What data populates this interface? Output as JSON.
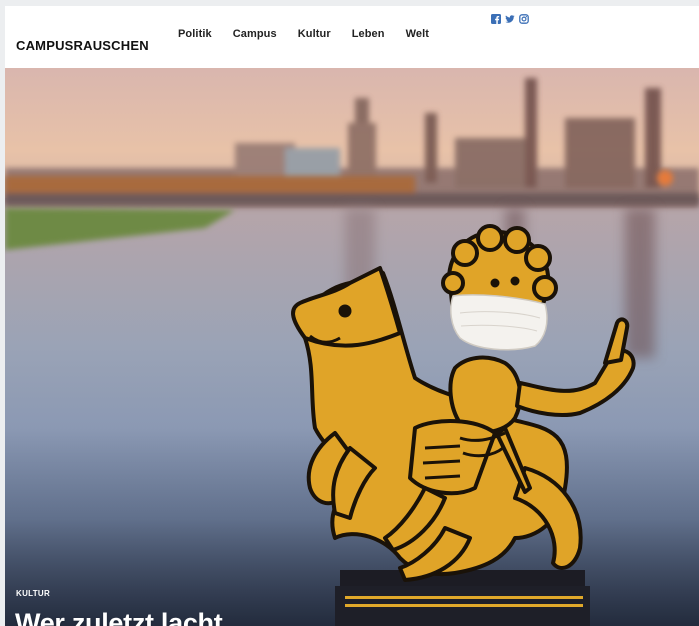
{
  "site": {
    "brand": "CAMPUSRAUSCHEN"
  },
  "nav": {
    "items": [
      "Politik",
      "Campus",
      "Kultur",
      "Leben",
      "Welt"
    ]
  },
  "social": {
    "icons": [
      "facebook-icon",
      "twitter-icon",
      "instagram-icon"
    ],
    "color": "#3b6fb6"
  },
  "hero": {
    "category": "KULTUR",
    "title": "Wer zuletzt lacht ..."
  },
  "colors": {
    "gold": "#e2a823",
    "outline": "#1a1208",
    "text": "#ffffff"
  }
}
